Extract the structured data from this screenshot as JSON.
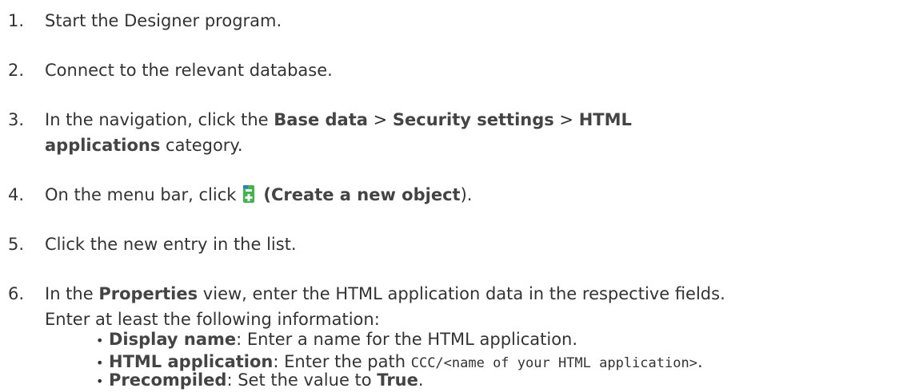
{
  "steps": [
    {
      "num": "1.",
      "text": "Start the Designer program."
    },
    {
      "num": "2.",
      "text": "Connect to the relevant database."
    },
    {
      "num": "3.",
      "pre": "In the navigation, click the ",
      "b1": "Base data",
      "sep1": " > ",
      "b2": "Security settings",
      "sep2": " > ",
      "b3": "HTML",
      "b3b": "applications",
      "post": " category."
    },
    {
      "num": "4.",
      "pre": "On the menu bar, click ",
      "icon": "create-new-object-icon",
      "b1": " (Create a new object",
      "post": ")."
    },
    {
      "num": "5.",
      "text": "Click the new entry in the list."
    },
    {
      "num": "6.",
      "pre": "In the ",
      "b1": "Properties",
      "post": " view, enter the HTML application data in the respective fields.",
      "line2": "Enter at least the following information:"
    }
  ],
  "bullets": [
    {
      "label": "Display name",
      "text": ": Enter a name for the HTML application."
    },
    {
      "label": "HTML application",
      "text": ": Enter the path ",
      "code": "CCC/<name of your HTML application>",
      "post": "."
    },
    {
      "label": "Precompiled",
      "text": ": Set the value to ",
      "value": "True",
      "post": "."
    }
  ],
  "colors": {
    "icon_green": "#3cb84a",
    "icon_blue": "#2e7fd0",
    "text": "#333333"
  }
}
